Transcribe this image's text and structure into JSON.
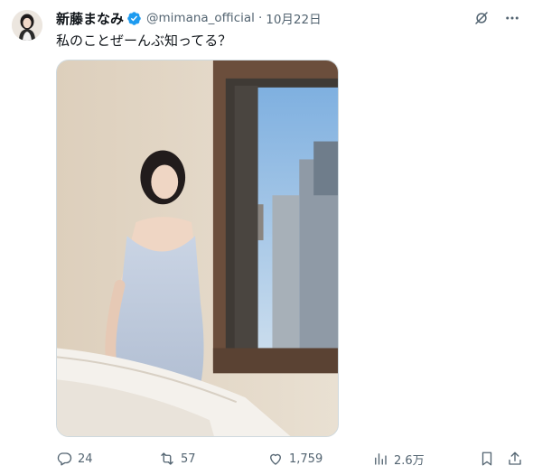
{
  "author": {
    "display_name": "新藤まなみ",
    "handle": "@mimana_official",
    "separator": "·",
    "date": "10月22日"
  },
  "tweet": {
    "text": "私のことぜーんぶ知ってる？"
  },
  "stats": {
    "replies": "24",
    "retweets": "57",
    "likes": "1,759",
    "views": "2.6万"
  },
  "colors": {
    "verified": "#1d9bf0",
    "secondary_text": "#536471",
    "primary_text": "#0f1419"
  },
  "icons": {
    "verified": "verified-badge-icon",
    "grok": "grok-icon",
    "more": "more-icon",
    "reply": "reply-icon",
    "retweet": "retweet-icon",
    "like": "heart-icon",
    "views": "views-chart-icon",
    "bookmark": "bookmark-icon",
    "share": "share-icon"
  }
}
